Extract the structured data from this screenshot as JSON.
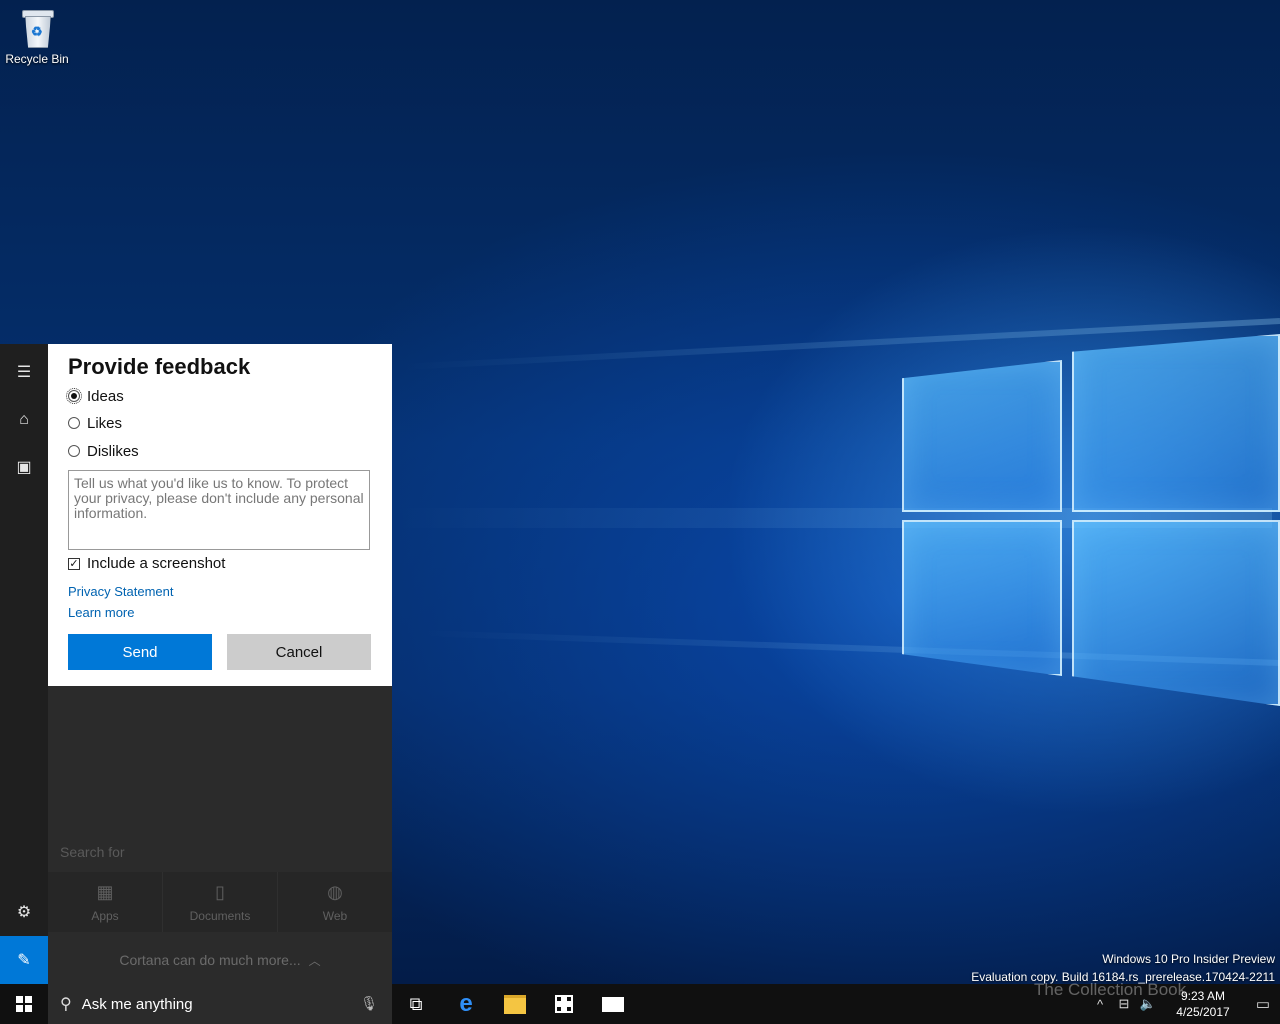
{
  "desktop": {
    "recycle_bin_label": "Recycle Bin",
    "build_line1": "Windows 10 Pro Insider Preview",
    "build_line2": "Evaluation copy. Build 16184.rs_prerelease.170424-2211",
    "watermark": "The Collection Book"
  },
  "feedback": {
    "title": "Provide feedback",
    "options": [
      "Ideas",
      "Likes",
      "Dislikes"
    ],
    "selected_option": "Ideas",
    "textarea_placeholder": "Tell us what you'd like us to know. To protect your privacy, please don't include any personal information.",
    "include_screenshot_label": "Include a screenshot",
    "include_screenshot_checked": true,
    "privacy_link": "Privacy Statement",
    "learn_more_link": "Learn more",
    "send_label": "Send",
    "cancel_label": "Cancel"
  },
  "cortana": {
    "search_for_label": "Search for",
    "filters": [
      {
        "label": "Apps",
        "icon": "apps-icon"
      },
      {
        "label": "Documents",
        "icon": "document-icon"
      },
      {
        "label": "Web",
        "icon": "globe-icon"
      }
    ],
    "more_label": "Cortana can do much more..."
  },
  "taskbar": {
    "search_placeholder": "Ask me anything",
    "time": "9:23 AM",
    "date": "4/25/2017"
  },
  "colors": {
    "accent": "#0078d7",
    "link": "#0063b1",
    "taskbar": "#101010",
    "cortana_panel": "#2b2b2b"
  }
}
